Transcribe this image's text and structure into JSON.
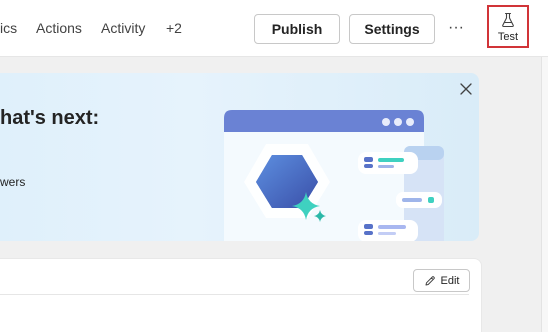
{
  "toolbar": {
    "nav": [
      "ics",
      "Actions",
      "Activity",
      "+2"
    ],
    "publish_label": "Publish",
    "settings_label": "Settings",
    "more_label": "···",
    "test_label": "Test"
  },
  "banner": {
    "title": "hat's next:",
    "body": "wers"
  },
  "card": {
    "edit_label": "Edit"
  },
  "icons": {
    "test": "flask-icon",
    "close": "close-icon",
    "edit": "pencil-icon",
    "more": "more-horizontal-icon"
  },
  "colors": {
    "test_highlight": "#d13438",
    "banner_bg": "#dff0fb",
    "illustration_accent": "#3fd1c0"
  }
}
